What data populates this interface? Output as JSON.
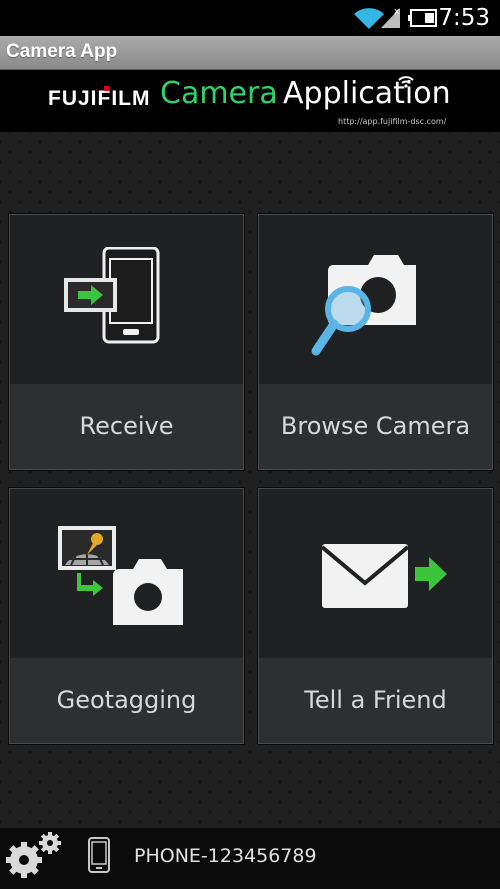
{
  "status_bar": {
    "time": "7:53",
    "icons": [
      "wifi-icon",
      "signal-icon",
      "battery-icon"
    ]
  },
  "title_bar": {
    "title": "Camera App"
  },
  "banner": {
    "brand": "FUJIFILM",
    "app_name_part1": "Camera",
    "app_name_part2": "Application",
    "url": "http://app.fujifilm-dsc.com/",
    "accent_color": "#2fd36a"
  },
  "tiles": [
    {
      "label": "Receive",
      "icon": "receive-phone-icon"
    },
    {
      "label": "Browse Camera",
      "icon": "browse-camera-icon"
    },
    {
      "label": "Geotagging",
      "icon": "geotagging-icon"
    },
    {
      "label": "Tell a Friend",
      "icon": "mail-arrow-icon"
    }
  ],
  "footer": {
    "device_name": "PHONE-123456789",
    "icons": [
      "settings-gears-icon",
      "phone-icon"
    ]
  }
}
